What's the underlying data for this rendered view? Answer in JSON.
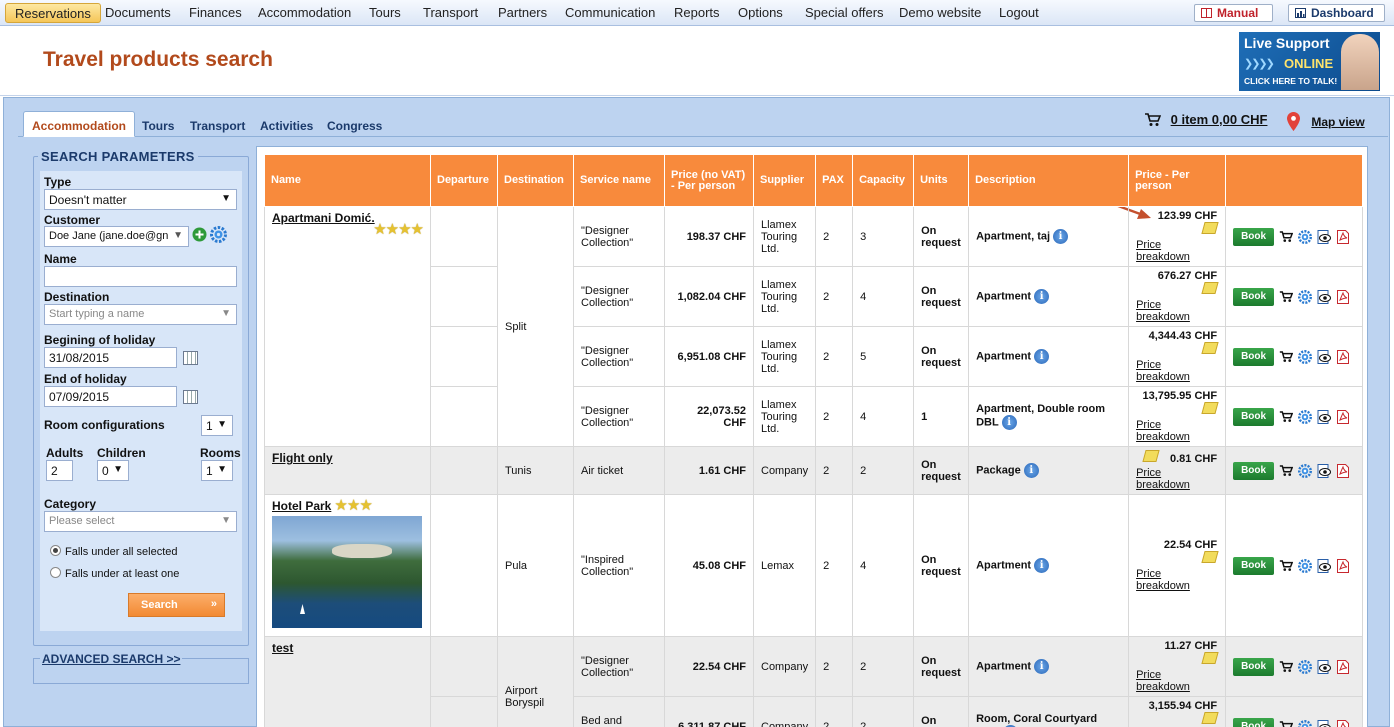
{
  "nav": {
    "items": [
      "Reservations",
      "Documents",
      "Finances",
      "Accommodation",
      "Tours",
      "Transport",
      "Partners",
      "Communication",
      "Reports",
      "Options",
      "Special offers",
      "Demo website",
      "Logout"
    ],
    "manual_label": "Manual",
    "dashboard_label": "Dashboard"
  },
  "header": {
    "title": "Travel products search",
    "live_support": {
      "line1": "Live Support",
      "line2": "ONLINE",
      "line3": "CLICK HERE TO TALK!"
    }
  },
  "tabs": [
    "Accommodation",
    "Tours",
    "Transport",
    "Activities",
    "Congress"
  ],
  "cart": {
    "label": "0 item 0,00 CHF"
  },
  "map_view": "Map view",
  "search": {
    "legend": "SEARCH PARAMETERS",
    "type_label": "Type",
    "type_value": "Doesn't matter",
    "customer_label": "Customer",
    "customer_value": "Doe Jane (jane.doe@gn",
    "name_label": "Name",
    "name_value": "",
    "destination_label": "Destination",
    "destination_placeholder": "Start typing a name",
    "begin_label": "Begining of holiday",
    "begin_value": "31/08/2015",
    "end_label": "End of holiday",
    "end_value": "07/09/2015",
    "room_config_label": "Room configurations",
    "room_config_value": "1",
    "adults_label": "Adults",
    "adults_value": "2",
    "children_label": "Children",
    "children_value": "0",
    "rooms_label": "Rooms",
    "rooms_value": "1",
    "category_label": "Category",
    "category_placeholder": "Please select",
    "radio_all": "Falls under all selected",
    "radio_one": "Falls under at least one",
    "search_button": "Search",
    "advanced": "ADVANCED SEARCH >>"
  },
  "table": {
    "headers": [
      "Name",
      "Departure",
      "Destination",
      "Service name",
      "Price (no VAT) - Per person",
      "Supplier",
      "PAX",
      "Capacity",
      "Units",
      "Description",
      "Price - Per person",
      ""
    ],
    "book_label": "Book",
    "price_breakdown": "Price breakdown",
    "products": [
      {
        "name": "Apartmani Domić.",
        "stars": 4,
        "destination": "Split",
        "rows": [
          {
            "service": "\"Designer Collection\"",
            "price": "198.37 CHF",
            "supplier": "Llamex Touring Ltd.",
            "pax": "2",
            "capacity": "3",
            "units": "On request",
            "description": "Apartment, taj",
            "pp": "123.99 CHF"
          },
          {
            "service": "\"Designer Collection\"",
            "price": "1,082.04 CHF",
            "supplier": "Llamex Touring Ltd.",
            "pax": "2",
            "capacity": "4",
            "units": "On request",
            "description": "Apartment",
            "pp": "676.27 CHF"
          },
          {
            "service": "\"Designer Collection\"",
            "price": "6,951.08 CHF",
            "supplier": "Llamex Touring Ltd.",
            "pax": "2",
            "capacity": "5",
            "units": "On request",
            "description": "Apartment",
            "pp": "4,344.43 CHF"
          },
          {
            "service": "\"Designer Collection\"",
            "price": "22,073.52 CHF",
            "supplier": "Llamex Touring Ltd.",
            "pax": "2",
            "capacity": "4",
            "units": "1",
            "description": "Apartment, Double room DBL",
            "pp": "13,795.95 CHF"
          }
        ]
      },
      {
        "name": "Flight only",
        "stars": 0,
        "destination": "Tunis",
        "rows": [
          {
            "service": "Air ticket",
            "price": "1.61 CHF",
            "supplier": "Company",
            "pax": "2",
            "capacity": "2",
            "units": "On request",
            "description": "Package",
            "pp": "0.81 CHF"
          }
        ]
      },
      {
        "name": "Hotel Park",
        "stars": 3,
        "destination": "Pula",
        "rows": [
          {
            "service": "\"Inspired Collection\"",
            "price": "45.08 CHF",
            "supplier": "Lemax",
            "pax": "2",
            "capacity": "4",
            "units": "On request",
            "description": "Apartment",
            "pp": "22.54 CHF"
          }
        ]
      },
      {
        "name": "test",
        "stars": 0,
        "destination": "Airport Boryspil",
        "rows": [
          {
            "service": "\"Designer Collection\"",
            "price": "22.54 CHF",
            "supplier": "Company",
            "pax": "2",
            "capacity": "2",
            "units": "On request",
            "description": "Apartment",
            "pp": "11.27 CHF"
          },
          {
            "service": "Bed and breakfast",
            "price": "6,311.87 CHF",
            "supplier": "Company",
            "pax": "2",
            "capacity": "2",
            "units": "On request",
            "description": "Room, Coral Courtyard view",
            "pp": "3,155.94 CHF"
          }
        ]
      }
    ]
  }
}
